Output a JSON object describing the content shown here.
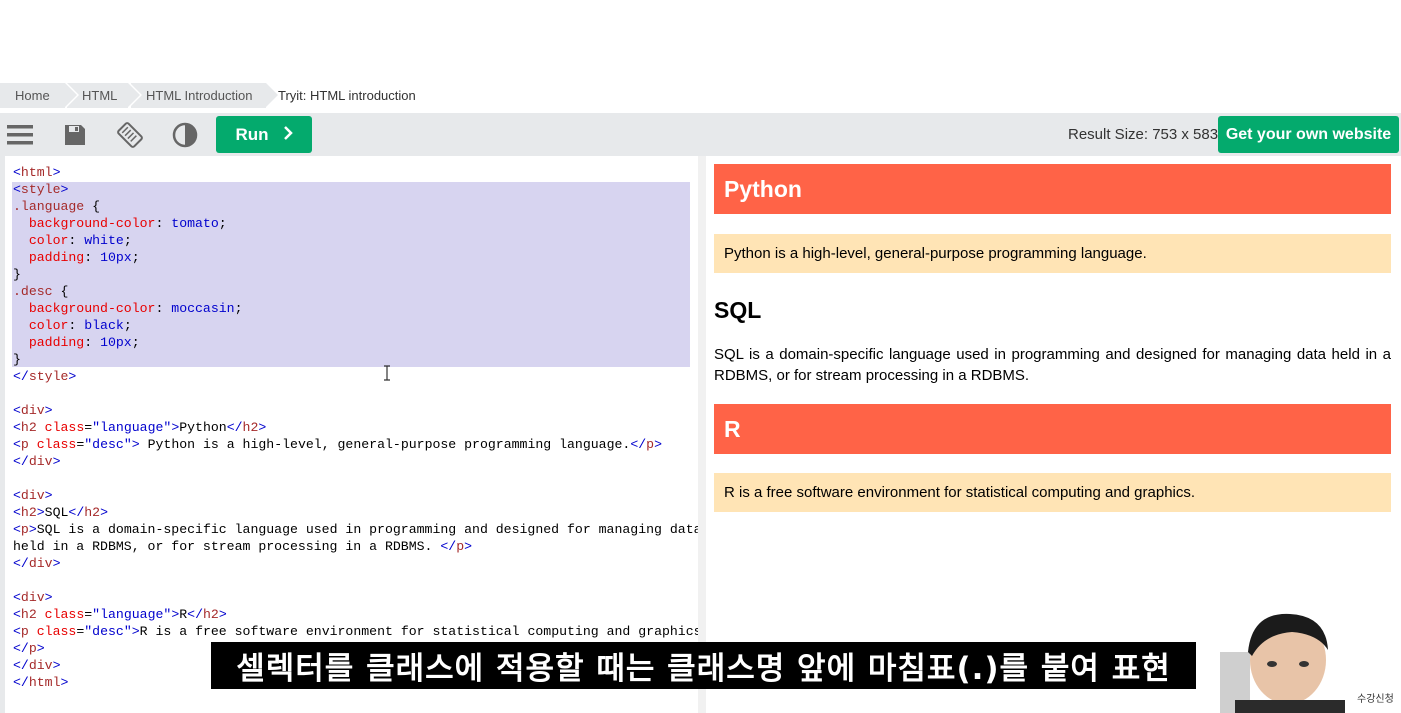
{
  "breadcrumb": [
    {
      "label": "Home"
    },
    {
      "label": "HTML"
    },
    {
      "label": "HTML Introduction"
    },
    {
      "label": "Tryit: HTML introduction"
    }
  ],
  "toolbar": {
    "icons": [
      "menu-icon",
      "save-icon",
      "rotate-icon",
      "contrast-icon"
    ],
    "run_label": "Run",
    "result_size": "Result Size: 753 x 583",
    "own_website_label": "Get your own website"
  },
  "colors": {
    "accent": "#04aa6d",
    "toolbar_bg": "#e7e9eb",
    "language_bg": "tomato",
    "desc_bg": "moccasin",
    "selection": "#d7d4f0"
  },
  "result": {
    "python_heading": "Python",
    "python_desc": "Python is a high-level, general-purpose programming language.",
    "sql_heading": "SQL",
    "sql_desc": "SQL is a domain-specific language used in programming and designed for managing data held in a RDBMS, or for stream processing in a RDBMS.",
    "r_heading": "R",
    "r_desc": "R is a free software environment for statistical computing and graphics."
  },
  "subtitle": "셀렉터를 클래스에 적용할 때는 클래스명 앞에 마침표(.)를 붙여 표현",
  "watermark": "수강신청"
}
